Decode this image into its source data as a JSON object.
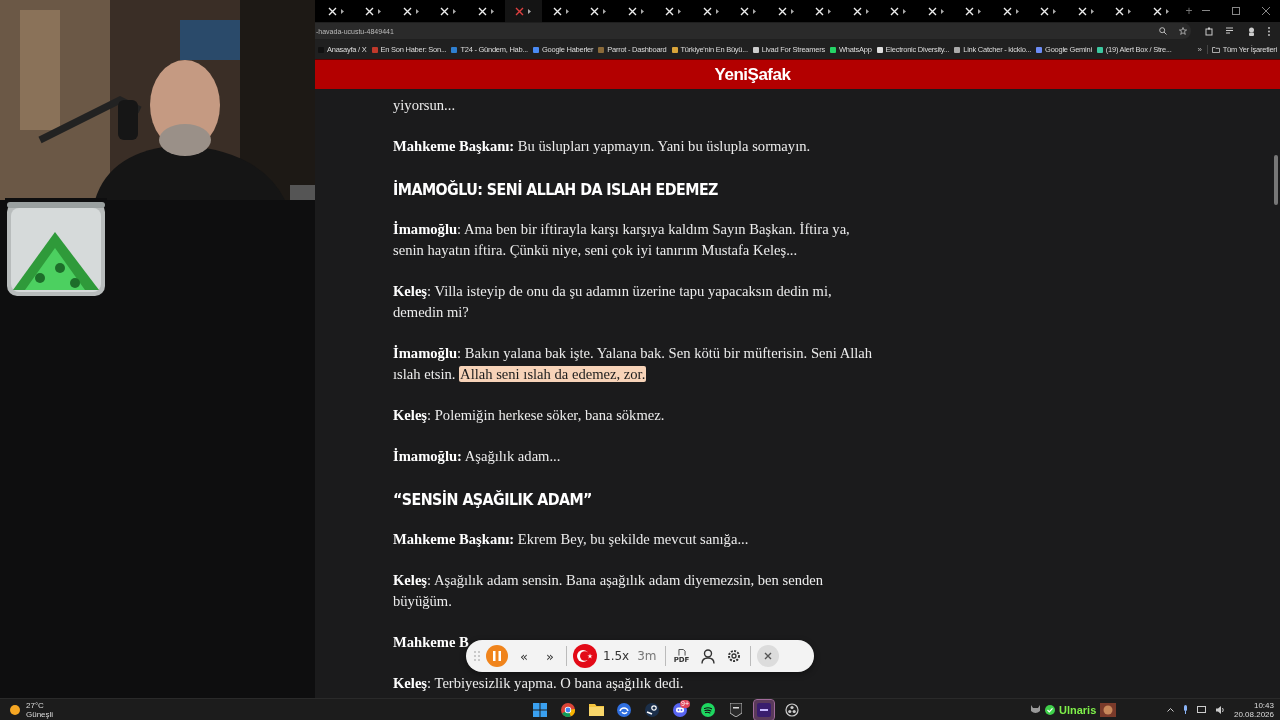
{
  "tabs": [
    {
      "selected": false
    },
    {
      "selected": false
    },
    {
      "selected": false
    },
    {
      "selected": false
    },
    {
      "selected": false
    },
    {
      "selected": true
    },
    {
      "selected": false
    },
    {
      "selected": false
    },
    {
      "selected": false
    },
    {
      "selected": false
    },
    {
      "selected": false
    },
    {
      "selected": false
    },
    {
      "selected": false
    },
    {
      "selected": false
    },
    {
      "selected": false
    },
    {
      "selected": false
    },
    {
      "selected": false
    },
    {
      "selected": false
    },
    {
      "selected": false
    },
    {
      "selected": false
    },
    {
      "selected": false
    },
    {
      "selected": false
    },
    {
      "selected": false
    }
  ],
  "new_tab": "+",
  "address_bar": {
    "url": "-havada-ucustu-4849441"
  },
  "bookmarks": [
    {
      "label": "Anasayfa / X",
      "color": "#111111"
    },
    {
      "label": "En Son Haber: Son...",
      "color": "#c0392b"
    },
    {
      "label": "T24 - Gündem, Hab...",
      "color": "#2f7fd0"
    },
    {
      "label": "Google Haberler",
      "color": "#4a8af4"
    },
    {
      "label": "Parrot - Dashboard",
      "color": "#8a6a3a"
    },
    {
      "label": "Türkiye'nin En Büyü...",
      "color": "#d9a43a"
    },
    {
      "label": "Livad For Streamers",
      "color": "#cccccc"
    },
    {
      "label": "WhatsApp",
      "color": "#25d366"
    },
    {
      "label": "Electronic Diversity...",
      "color": "#dddddd"
    },
    {
      "label": "Link Catcher - kicklo...",
      "color": "#aaaaaa"
    },
    {
      "label": "Google Gemini",
      "color": "#6c8cf5"
    },
    {
      "label": "(19) Alert Box / Stre...",
      "color": "#3cc8a0"
    }
  ],
  "bookmarks_overflow": "»",
  "all_bookmarks": "Tüm Yer İşaretleri",
  "site_header": {
    "logo": "YeniŞafak"
  },
  "article": [
    {
      "kind": "paragraph",
      "text": "yiyorsun..."
    },
    {
      "kind": "paragraph",
      "text": "**Mahkeme Başkanı:** Bu üslupları yapmayın. Yani bu üslupla sormayın."
    },
    {
      "kind": "heading",
      "text": "İMAMOĞLU: SENİ ALLAH DA ISLAH EDEMEZ"
    },
    {
      "kind": "paragraph",
      "text": "**İmamoğlu**: Ama ben bir iftirayla karşı karşıya kaldım Sayın Başkan. İftira ya, senin hayatın iftira. Çünkü niye, seni çok iyi tanırım Mustafa Keleş..."
    },
    {
      "kind": "paragraph",
      "text": "**Keleş**: Villa isteyip de onu da şu adamın üzerine tapu yapacaksın dedin mi, demedin mi?"
    },
    {
      "kind": "paragraph",
      "text": "**İmamoğlu**: Bakın yalana bak işte. Yalana bak. Sen kötü bir müfterisin. Seni Allah ıslah etsin.",
      "highlight": "Allah seni ıslah da edemez, zor."
    },
    {
      "kind": "paragraph",
      "text": "**Keleş**: Polemiğin herkese söker, bana sökmez."
    },
    {
      "kind": "paragraph",
      "text": "**İmamoğlu:** Aşağılık adam..."
    },
    {
      "kind": "heading",
      "text": "“SENSİN AŞAĞILIK ADAM”"
    },
    {
      "kind": "paragraph",
      "text": "**Mahkeme Başkanı:** Ekrem Bey, bu şekilde mevcut sanığa..."
    },
    {
      "kind": "paragraph",
      "text": "**Keleş**: Aşağılık adam sensin. Bana aşağılık adam diyemezsin, ben senden büyüğüm."
    },
    {
      "kind": "paragraph",
      "text": "**Mahkeme B**"
    },
    {
      "kind": "paragraph",
      "text": "**Keleş**: Terbiyesizlik yapma. O bana aşağılık dedi."
    }
  ],
  "reader_toolbar": {
    "playing": true,
    "rewind": "«",
    "forward": "»",
    "speed": "1.5x",
    "time_left": "3m",
    "pdf_label": "PDF"
  },
  "taskbar": {
    "weather": {
      "temperature": "27°C",
      "condition": "Güneşli"
    },
    "apps": [
      {
        "kind": "start",
        "active": false
      },
      {
        "kind": "chrome",
        "active": false
      },
      {
        "kind": "folder",
        "active": false
      },
      {
        "kind": "swirl",
        "active": false
      },
      {
        "kind": "steam",
        "active": false
      },
      {
        "kind": "discord",
        "active": false,
        "badge": "9+"
      },
      {
        "kind": "spotify",
        "active": false
      },
      {
        "kind": "shield",
        "active": false
      },
      {
        "kind": "tile",
        "active": true
      },
      {
        "kind": "obs",
        "active": false
      }
    ],
    "user": "Ulnaris",
    "time": "10:43",
    "date": "20.08.2026"
  }
}
